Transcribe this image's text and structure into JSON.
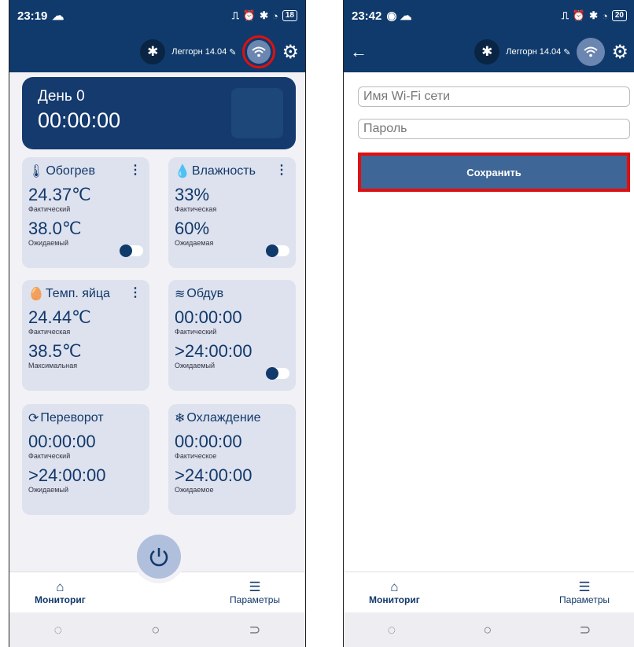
{
  "screen1": {
    "status": {
      "time": "23:19",
      "battery": "18"
    },
    "appbar": {
      "device": "Леггорн 14.04"
    },
    "header": {
      "day": "День 0",
      "time": "00:00:00"
    },
    "cards": [
      {
        "title": "Обогрев",
        "v1": "24.37℃",
        "l1": "Фактический",
        "v2": "38.0℃",
        "l2": "Ожидаемый"
      },
      {
        "title": "Влажность",
        "v1": "33%",
        "l1": "Фактическая",
        "v2": "60%",
        "l2": "Ожидаемая"
      },
      {
        "title": "Темп. яйца",
        "v1": "24.44℃",
        "l1": "Фактическая",
        "v2": "38.5℃",
        "l2": "Максимальная"
      },
      {
        "title": "Обдув",
        "v1": "00:00:00",
        "l1": "Фактический",
        "v2": ">24:00:00",
        "l2": "Ожидаемый"
      },
      {
        "title": "Переворот",
        "v1": "00:00:00",
        "l1": "Фактический",
        "v2": ">24:00:00",
        "l2": "Ожидаемый"
      },
      {
        "title": "Охлаждение",
        "v1": "00:00:00",
        "l1": "Фактическое",
        "v2": ">24:00:00",
        "l2": "Ожидаемое"
      }
    ]
  },
  "screen2": {
    "status": {
      "time": "23:42",
      "battery": "20"
    },
    "appbar": {
      "device": "Леггорн 14.04"
    },
    "form": {
      "ssid_placeholder": "Имя Wi-Fi сети",
      "password_placeholder": "Пароль",
      "save_label": "Сохранить"
    }
  },
  "nav": {
    "monitoring": "Мониториг",
    "parameters": "Параметры"
  },
  "icons": {
    "cloud": "cloud-icon",
    "bluetooth": "bluetooth-icon",
    "wifi": "wifi-icon",
    "gear": "gear-icon",
    "edit": "edit-icon",
    "power": "power-icon",
    "home": "home-icon",
    "list": "list-icon",
    "thermometer": "thermometer-icon",
    "drop": "drop-icon",
    "egg": "egg-icon",
    "wind": "wind-icon",
    "rotate": "rotate-icon",
    "snowflake": "snowflake-icon"
  },
  "colors": {
    "primary": "#0f3a6b",
    "card": "#dde2ee",
    "highlight": "#e01010",
    "button": "#3e6696"
  }
}
